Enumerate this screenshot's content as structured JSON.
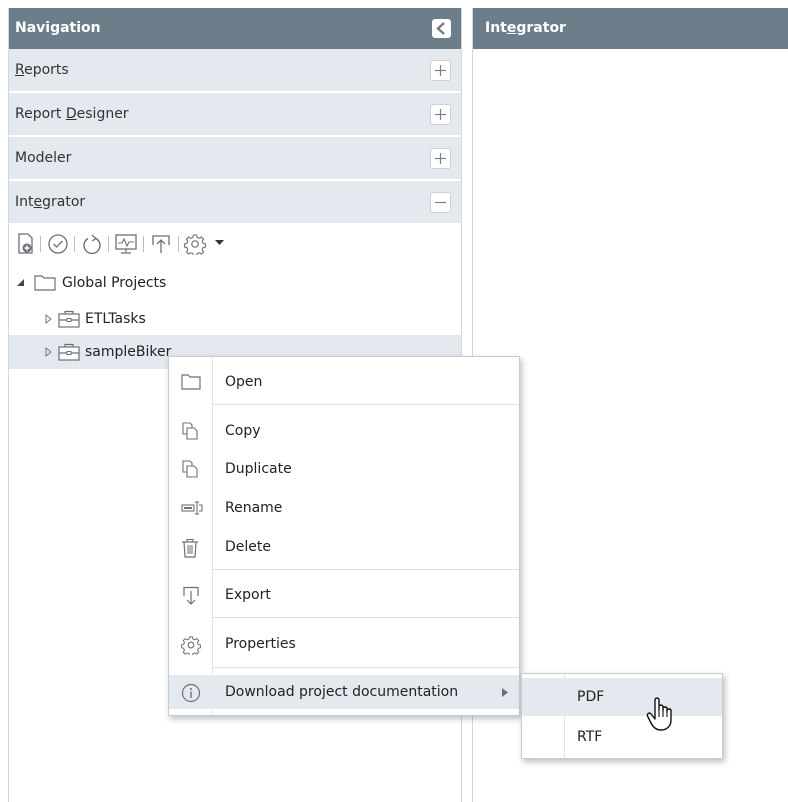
{
  "navigation": {
    "title": "Navigation",
    "sections": [
      {
        "id": "reports",
        "pre": "",
        "u": "R",
        "post": "eports",
        "state": "collapsed"
      },
      {
        "id": "report-designer",
        "pre": "Report ",
        "u": "D",
        "post": "esigner",
        "state": "collapsed"
      },
      {
        "id": "modeler",
        "pre": "Modeler",
        "u": "",
        "post": "",
        "state": "collapsed"
      },
      {
        "id": "integrator",
        "pre": "Int",
        "u": "e",
        "post": "grator",
        "state": "expanded"
      }
    ]
  },
  "toolbar": {
    "icons": [
      "new-project-icon",
      "validate-icon",
      "refresh-icon",
      "monitor-icon",
      "deploy-icon",
      "settings-icon",
      "dropdown-arrow-icon"
    ]
  },
  "tree": {
    "root": {
      "label": "Global Projects",
      "expanded": true
    },
    "children": [
      {
        "label": "ETLTasks",
        "expanded": false
      },
      {
        "label": "sampleBiker",
        "expanded": false,
        "selected": true
      }
    ]
  },
  "integrator_panel": {
    "pre": "Int",
    "u": "e",
    "post": "grator"
  },
  "context_menu": {
    "items": [
      {
        "label": "Open",
        "icon": "folder-icon"
      },
      {
        "label": "Copy",
        "icon": "copy-icon"
      },
      {
        "label": "Duplicate",
        "icon": "duplicate-icon"
      },
      {
        "label": "Rename",
        "icon": "rename-icon"
      },
      {
        "label": "Delete",
        "icon": "trash-icon"
      },
      {
        "label": "Export",
        "icon": "export-icon"
      },
      {
        "label": "Properties",
        "icon": "gear-icon"
      },
      {
        "label": "Download project documentation",
        "icon": "info-icon",
        "has_submenu": true,
        "highlighted": true
      }
    ]
  },
  "submenu": {
    "items": [
      {
        "label": "PDF",
        "highlighted": true
      },
      {
        "label": "RTF"
      }
    ]
  },
  "colors": {
    "header_bg": "#6d7e8b",
    "row_bg": "#e3e9ef",
    "highlight_bg": "#e3e9ef",
    "border": "#c6cbd0",
    "icon": "#6b7178"
  }
}
